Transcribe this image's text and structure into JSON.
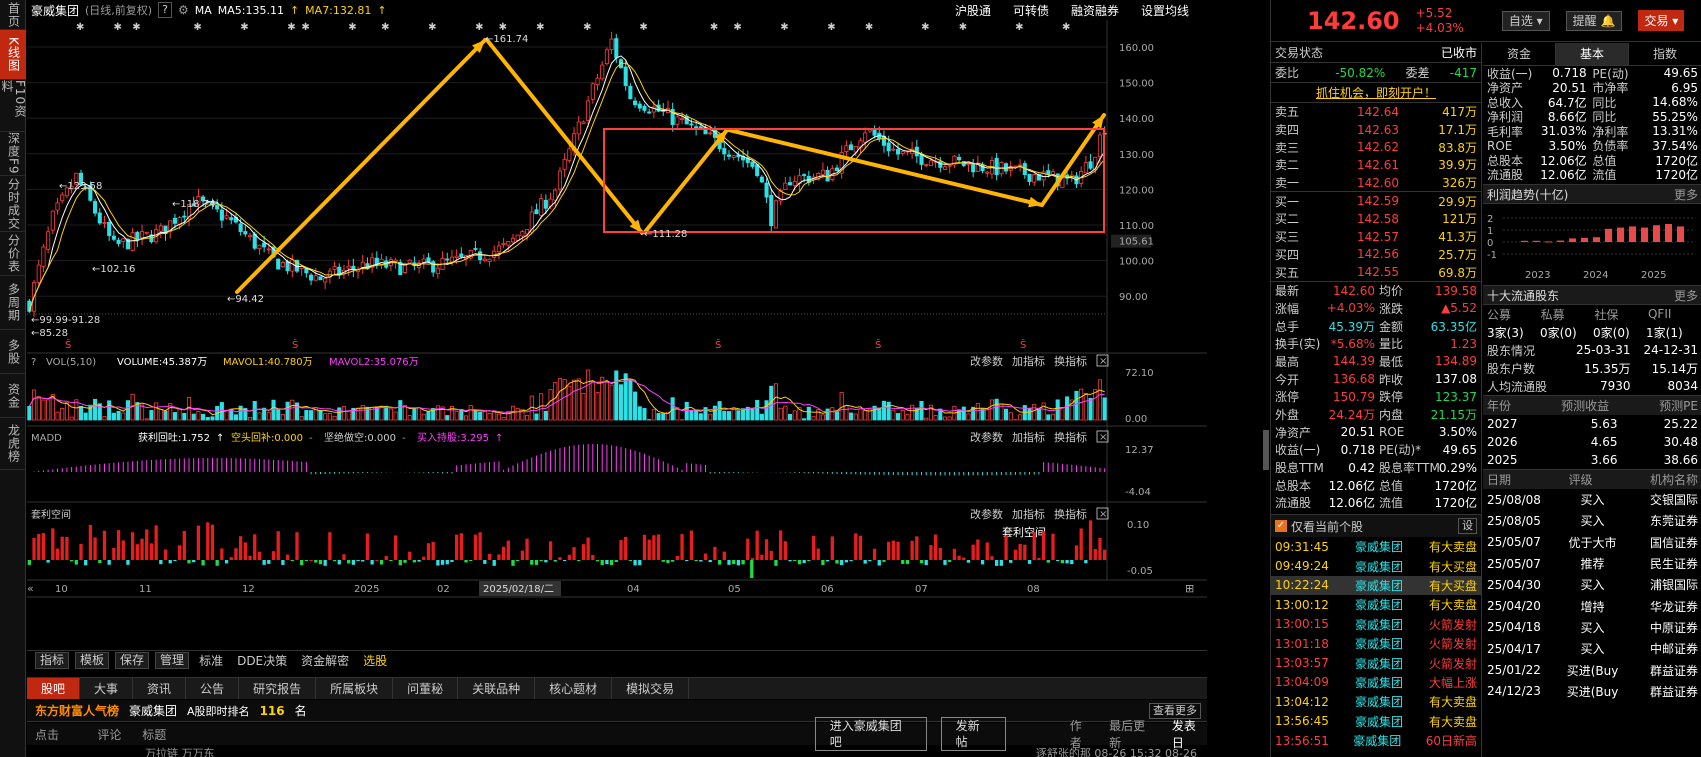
{
  "left_nav": [
    {
      "label": "首页",
      "active": false
    },
    {
      "label": "K线图",
      "active": true
    },
    {
      "label": "F10资料",
      "active": false
    },
    {
      "label": "深度F9",
      "active": false
    },
    {
      "label": "分时成交",
      "active": false
    },
    {
      "label": "分价表",
      "active": false
    },
    {
      "label": "多周期",
      "active": false
    },
    {
      "label": "多股",
      "active": false
    },
    {
      "label": "资金",
      "active": false
    },
    {
      "label": "龙虎榜",
      "active": false
    }
  ],
  "header": {
    "stock_name": "豪威集团",
    "period": "(日线,前复权)",
    "help": "?",
    "ma_label": "MA",
    "ma5": "MA5:135.11",
    "ma7": "MA7:132.81",
    "links": [
      "沪股通",
      "可转债",
      "融资融券",
      "设置均线"
    ]
  },
  "price_axis": [
    "160.00",
    "150.00",
    "140.00",
    "130.00",
    "120.00",
    "110.00",
    "105.61",
    "100.00",
    "90.00"
  ],
  "price_annotations": {
    "high": "161.74",
    "mid_high": "123.58",
    "mid2": "118.74",
    "low1": "102.16",
    "low2": "94.42",
    "left_low": "99.99-91.28",
    "min": "85.28",
    "dip": "111.28"
  },
  "vol_head": {
    "label": "VOL(5,10)",
    "volume": "VOLUME:45.387万",
    "mavol1": "MAVOL1:40.780万",
    "mavol2": "MAVOL2:35.076万",
    "actions": [
      "改参数",
      "加指标",
      "换指标"
    ]
  },
  "vol_axis": [
    "72.10",
    "0.00"
  ],
  "madd_head": {
    "label": "MADD",
    "profit": "获利回吐:1.752",
    "short": "空头回补:0.000",
    "firm": "坚绝做空:0.000",
    "buy": "买入持股:3.295",
    "actions": [
      "改参数",
      "加指标",
      "换指标"
    ]
  },
  "madd_axis": [
    "12.37",
    "-4.04"
  ],
  "arb_head": {
    "label": "套利空间",
    "tag": "套利空间",
    "actions": [
      "改参数",
      "加指标",
      "换指标"
    ]
  },
  "arb_axis": [
    "0.10",
    "-0.05"
  ],
  "time_axis": [
    "10",
    "11",
    "12",
    "2025",
    "02",
    "2025/02/18/二",
    "04",
    "05",
    "06",
    "07",
    "08"
  ],
  "toolbar": {
    "buttons": [
      "指标",
      "模板",
      "保存",
      "管理"
    ],
    "plain": [
      "标准",
      "DDE决策",
      "资金解密",
      "选股"
    ]
  },
  "bottom_tabs": [
    {
      "label": "股吧",
      "active": true
    },
    {
      "label": "大事"
    },
    {
      "label": "资讯"
    },
    {
      "label": "公告"
    },
    {
      "label": "研究报告"
    },
    {
      "label": "所属板块"
    },
    {
      "label": "问董秘"
    },
    {
      "label": "关联品种"
    },
    {
      "label": "核心题材"
    },
    {
      "label": "模拟交易"
    }
  ],
  "hot": {
    "title": "东方财富人气榜",
    "stock": "豪威集团",
    "rank_label": "A股即时排名",
    "rank": "116",
    "unit": "名",
    "more": "查看更多"
  },
  "post": {
    "cols": [
      "点击",
      "评论",
      "标题"
    ],
    "enter": "进入豪威集团吧",
    "new_post": "发新帖",
    "author": "作者",
    "last_update": "最后更新",
    "post_date": "发表日"
  },
  "post_row": {
    "text": "万拉链 万万东",
    "meta": "逐舒张的那 08-26 15:32 08-26"
  },
  "quote": {
    "price": "142.60",
    "change": "+5.52",
    "pct": "+4.03%",
    "select": "自选",
    "remind": "提醒",
    "trade": "交易",
    "status_label": "交易状态",
    "status": "已收市",
    "weibi_label": "委比",
    "weibi": "-50.82%",
    "weicha_label": "委差",
    "weicha": "-417",
    "promo": "抓住机会，即刻开户！"
  },
  "asks": [
    [
      "卖五",
      "142.64",
      "417万"
    ],
    [
      "卖四",
      "142.63",
      "17.1万"
    ],
    [
      "卖三",
      "142.62",
      "83.8万"
    ],
    [
      "卖二",
      "142.61",
      "39.9万"
    ],
    [
      "卖一",
      "142.60",
      "326万"
    ]
  ],
  "bids": [
    [
      "买一",
      "142.59",
      "29.9万"
    ],
    [
      "买二",
      "142.58",
      "121万"
    ],
    [
      "买三",
      "142.57",
      "41.3万"
    ],
    [
      "买四",
      "142.56",
      "25.7万"
    ],
    [
      "买五",
      "142.55",
      "69.8万"
    ]
  ],
  "stats": [
    [
      "最新",
      "142.60",
      "均价",
      "139.58"
    ],
    [
      "涨幅",
      "+4.03%",
      "涨跌",
      "▲5.52"
    ],
    [
      "总手",
      "45.39万",
      "金额",
      "63.35亿"
    ],
    [
      "换手(实)",
      "*5.68%",
      "量比",
      "1.23"
    ],
    [
      "最高",
      "144.39",
      "最低",
      "134.89"
    ],
    [
      "今开",
      "136.68",
      "昨收",
      "137.08"
    ],
    [
      "涨停",
      "150.79",
      "跌停",
      "123.37"
    ],
    [
      "外盘",
      "24.24万",
      "内盘",
      "21.15万"
    ],
    [
      "净资产",
      "20.51",
      "ROE",
      "3.50%"
    ],
    [
      "收益(一)",
      "0.718",
      "PE(动)*",
      "49.65"
    ],
    [
      "股息TTM",
      "0.42",
      "股息率TTM",
      "0.29%"
    ],
    [
      "总股本",
      "12.06亿",
      "总值",
      "1720亿"
    ],
    [
      "流通股",
      "12.06亿",
      "流值",
      "1720亿"
    ]
  ],
  "ticker_head": {
    "label": "仅看当前个股",
    "btn": "设"
  },
  "ticker": [
    [
      "09:31:45",
      "豪威集团",
      "有大卖盘"
    ],
    [
      "09:49:24",
      "豪威集团",
      "有大买盘"
    ],
    [
      "10:22:24",
      "豪威集团",
      "有大买盘"
    ],
    [
      "13:00:12",
      "豪威集团",
      "有大卖盘"
    ],
    [
      "13:00:15",
      "豪威集团",
      "火箭发射"
    ],
    [
      "13:01:18",
      "豪威集团",
      "火箭发射"
    ],
    [
      "13:03:57",
      "豪威集团",
      "火箭发射"
    ],
    [
      "13:04:09",
      "豪威集团",
      "大幅上涨"
    ],
    [
      "13:04:12",
      "豪威集团",
      "有大卖盘"
    ],
    [
      "13:56:45",
      "豪威集团",
      "有大卖盘"
    ],
    [
      "13:56:51",
      "豪威集团",
      "60日新高"
    ]
  ],
  "fund_tabs": [
    "资金",
    "基本",
    "指数"
  ],
  "fund": [
    [
      "收益(一)",
      "0.718",
      "PE(动)",
      "49.65"
    ],
    [
      "净资产",
      "20.51",
      "市净率",
      "6.95"
    ],
    [
      "总收入",
      "64.7亿",
      "同比",
      "14.68%"
    ],
    [
      "净利润",
      "8.66亿",
      "同比",
      "55.25%"
    ],
    [
      "毛利率",
      "31.03%",
      "净利率",
      "13.31%"
    ],
    [
      "ROE",
      "3.50%",
      "负债率",
      "37.54%"
    ],
    [
      "总股本",
      "12.06亿",
      "总值",
      "1720亿"
    ],
    [
      "流通股",
      "12.06亿",
      "流值",
      "1720亿"
    ]
  ],
  "profit_trend": {
    "title": "利润趋势(十亿)",
    "more": "更多",
    "y": [
      "2",
      "1",
      "0",
      "-1"
    ],
    "years": [
      "2023",
      "2024",
      "2025"
    ],
    "values": [
      0.1,
      0.1,
      0.05,
      0.12,
      0.3,
      0.35,
      0.4,
      1.1,
      1.2,
      1.3,
      1.2,
      1.4,
      1.5,
      1.3
    ]
  },
  "holders": {
    "title": "十大流通股东",
    "more": "更多",
    "types": [
      "公募",
      "私募",
      "社保",
      "QFII"
    ],
    "counts": [
      "3家(3)",
      "0家(0)",
      "0家(0)",
      "1家(1)"
    ],
    "rows": [
      [
        "股东情况",
        "25-03-31",
        "24-12-31"
      ],
      [
        "股东户数",
        "15.35万",
        "15.14万"
      ],
      [
        "人均流通股",
        "7930",
        "8034"
      ]
    ]
  },
  "forecast": {
    "cols": [
      "年份",
      "预测收益",
      "预测PE"
    ],
    "rows": [
      [
        "2027",
        "5.63",
        "25.22"
      ],
      [
        "2026",
        "4.65",
        "30.48"
      ],
      [
        "2025",
        "3.66",
        "38.66"
      ]
    ]
  },
  "ratings": {
    "cols": [
      "日期",
      "评级",
      "机构名称"
    ],
    "rows": [
      [
        "25/08/08",
        "买入",
        "交银国际"
      ],
      [
        "25/08/05",
        "买入",
        "东莞证券"
      ],
      [
        "25/05/07",
        "优于大市",
        "国信证券"
      ],
      [
        "25/05/07",
        "推荐",
        "民生证券"
      ],
      [
        "25/04/30",
        "买入",
        "浦银国际"
      ],
      [
        "25/04/20",
        "增持",
        "华龙证券"
      ],
      [
        "25/04/18",
        "买入",
        "中原证券"
      ],
      [
        "25/04/17",
        "买入",
        "中邮证券"
      ],
      [
        "25/01/22",
        "买进(Buy",
        "群益证券"
      ],
      [
        "24/12/23",
        "买进(Buy",
        "群益证券"
      ]
    ]
  },
  "colors": {
    "up": "#ff3c3c",
    "down": "#2ce1e6",
    "ma5": "#ffffff",
    "ma7": "#ffd200",
    "accent": "#c0280f",
    "annot": "#ffb400",
    "box": "#ff4040"
  }
}
